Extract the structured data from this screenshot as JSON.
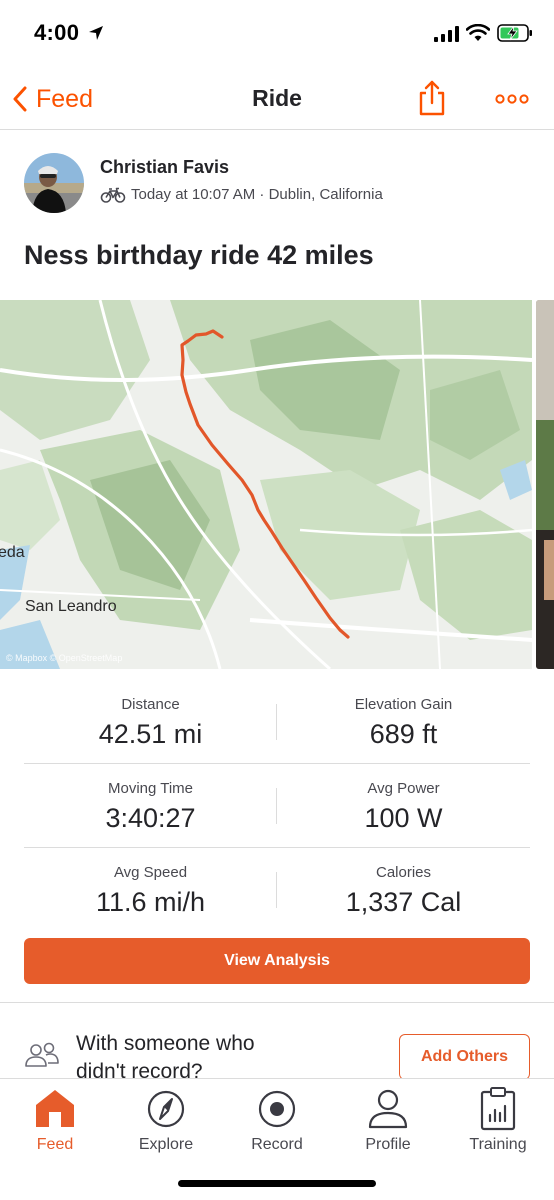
{
  "status_bar": {
    "time": "4:00"
  },
  "nav": {
    "back_label": "Feed",
    "title": "Ride"
  },
  "athlete": {
    "name": "Christian Favis",
    "meta": "Today at 10:07 AM · Dublin, California"
  },
  "activity": {
    "title": "Ness birthday ride 42 miles",
    "map_labels": [
      "eda",
      "San Leandro"
    ],
    "map_attribution": "© Mapbox © OpenStreetMap"
  },
  "stats": [
    {
      "label": "Distance",
      "value": "42.51 mi"
    },
    {
      "label": "Elevation Gain",
      "value": "689 ft"
    },
    {
      "label": "Moving Time",
      "value": "3:40:27"
    },
    {
      "label": "Avg Power",
      "value": "100 W"
    },
    {
      "label": "Avg Speed",
      "value": "11.6 mi/h"
    },
    {
      "label": "Calories",
      "value": "1,337 Cal"
    }
  ],
  "actions": {
    "view_analysis": "View Analysis",
    "with_others": "With someone who didn't record?",
    "add_others": "Add Others"
  },
  "tabs": [
    {
      "label": "Feed",
      "icon": "home-icon",
      "active": true
    },
    {
      "label": "Explore",
      "icon": "compass-icon",
      "active": false
    },
    {
      "label": "Record",
      "icon": "record-icon",
      "active": false
    },
    {
      "label": "Profile",
      "icon": "profile-icon",
      "active": false
    },
    {
      "label": "Training",
      "icon": "training-clipboard-icon",
      "active": false
    }
  ],
  "colors": {
    "accent": "#fc5200",
    "button": "#e65c2b",
    "route": "#e2572a",
    "map_green": "#c9dcbf"
  }
}
